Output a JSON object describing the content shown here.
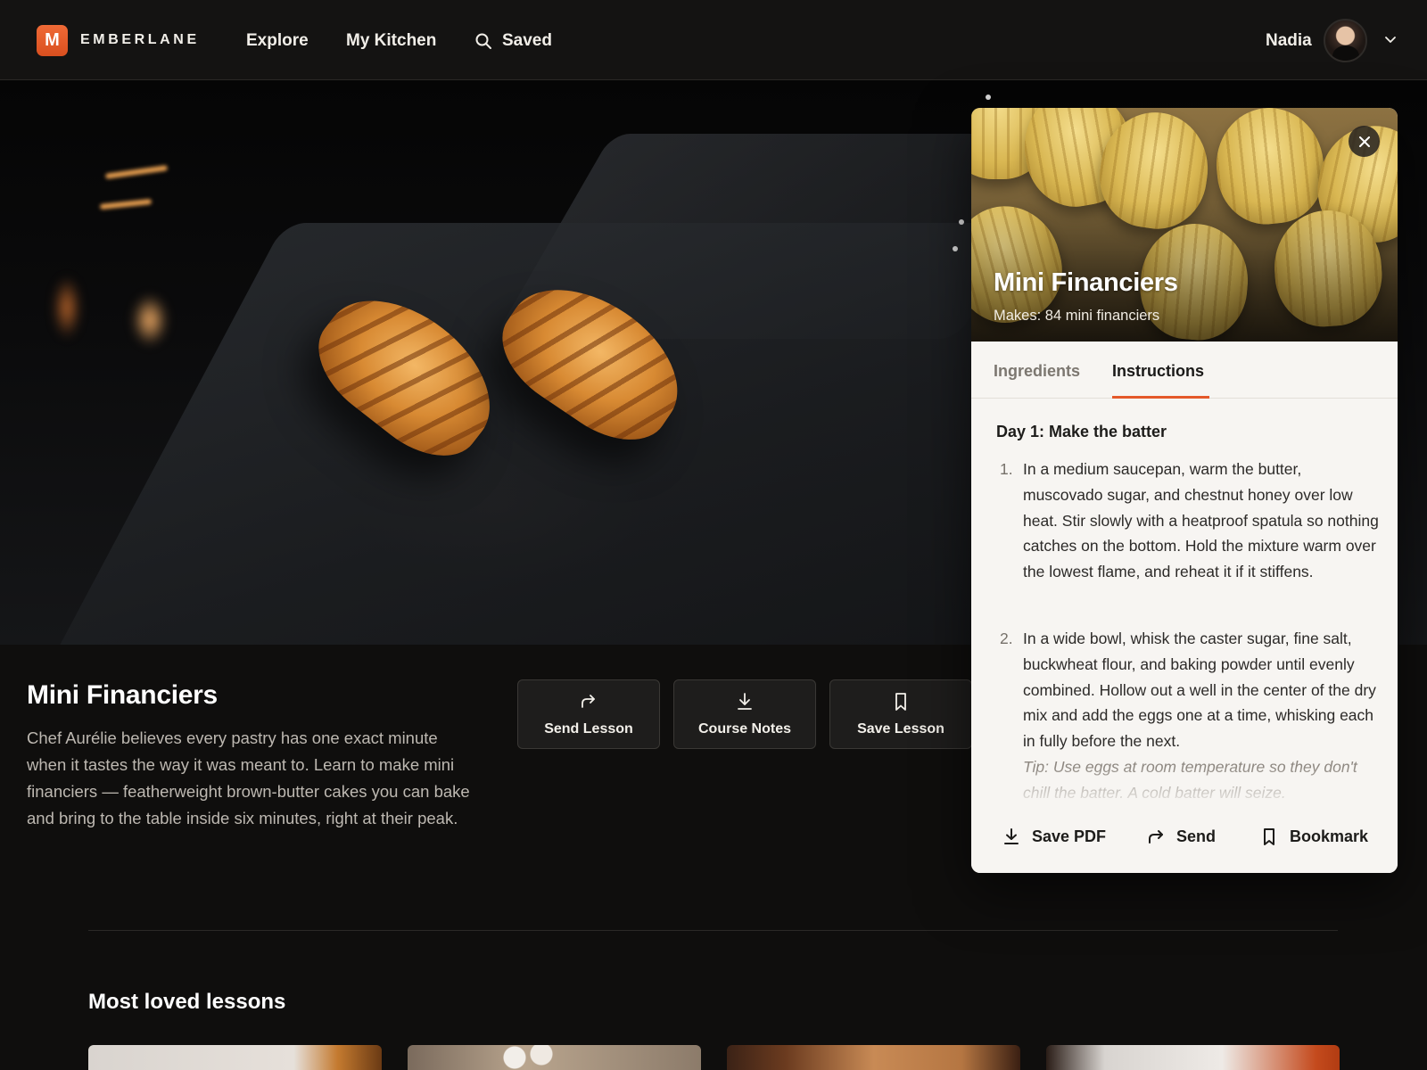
{
  "brand": {
    "mark": "M",
    "name": "EMBERLANE",
    "accent": "#e4582a"
  },
  "nav": {
    "explore": "Explore",
    "kitchen": "My Kitchen",
    "saved": "Saved"
  },
  "user": {
    "name": "Nadia"
  },
  "lesson": {
    "title": "Mini Financiers",
    "description": "Chef Aurélie believes every pastry has one exact minute when it tastes the way it was meant to. Learn to make mini financiers — featherweight brown-butter cakes you can bake and bring to the table inside six minutes, right at their peak.",
    "actions": {
      "send": "Send Lesson",
      "notes": "Course Notes",
      "save": "Save Lesson"
    }
  },
  "section": {
    "title": "Most loved lessons"
  },
  "panel": {
    "title": "Mini Financiers",
    "makes": "Makes: 84 mini financiers",
    "tabs": {
      "ingredients": "Ingredients",
      "instructions": "Instructions"
    },
    "active_tab": "Instructions",
    "day_heading": "Day 1: Make the batter",
    "steps": [
      {
        "num": "1.",
        "text": "In a medium saucepan, warm the butter, muscovado sugar, and chestnut honey over low heat. Stir slowly with a heatproof spatula so nothing catches on the bottom. Hold the mixture warm over the lowest flame, and reheat it if it stiffens."
      },
      {
        "num": "2.",
        "text": "In a wide bowl, whisk the caster sugar, fine salt, buckwheat flour, and baking powder until evenly combined. Hollow out a well in the center of the dry mix and add the eggs one at a time, whisking each in fully before the next."
      }
    ],
    "tip": "Tip: Use eggs at room temperature so they don't chill the batter. A cold batter will seize.",
    "footer": {
      "save_pdf": "Save PDF",
      "send": "Send",
      "bookmark": "Bookmark"
    }
  }
}
